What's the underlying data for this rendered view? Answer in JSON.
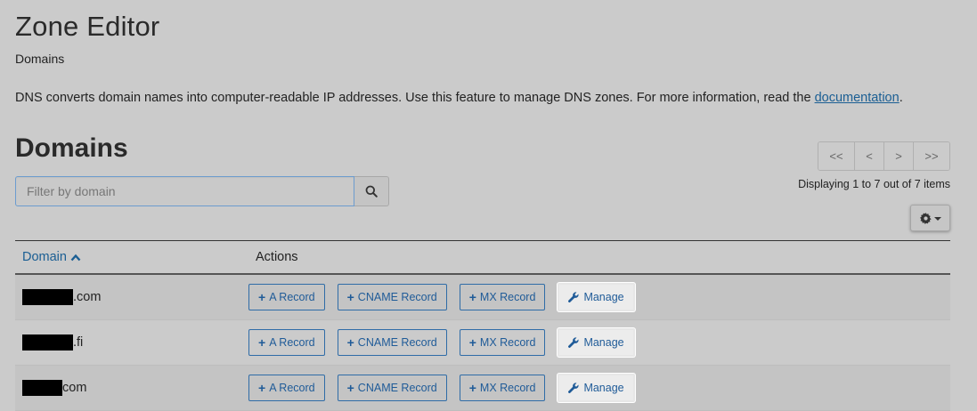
{
  "header": {
    "title": "Zone Editor",
    "breadcrumb": "Domains",
    "description_text": "DNS converts domain names into computer-readable IP addresses. Use this feature to manage DNS zones. For more information, read the ",
    "description_link": "documentation",
    "description_end": "."
  },
  "section": {
    "title": "Domains"
  },
  "search": {
    "placeholder": "Filter by domain",
    "value": "",
    "icon": "search-icon"
  },
  "pagination": {
    "first": "<<",
    "prev": "<",
    "next": ">",
    "last": ">>",
    "info": "Displaying 1 to 7 out of 7 items"
  },
  "settings": {
    "icon": "gear-icon"
  },
  "table": {
    "columns": {
      "domain": "Domain",
      "actions": "Actions"
    },
    "sort_icon": "chevron-up-icon",
    "rows": [
      {
        "suffix": ".com"
      },
      {
        "suffix": ".fi"
      },
      {
        "suffix": "com"
      }
    ],
    "buttons": {
      "a_record": "A Record",
      "cname_record": "CNAME Record",
      "mx_record": "MX Record",
      "manage": "Manage"
    }
  },
  "colors": {
    "link": "#1a5e93",
    "background": "#cbcbcb",
    "redaction": "#000000"
  }
}
